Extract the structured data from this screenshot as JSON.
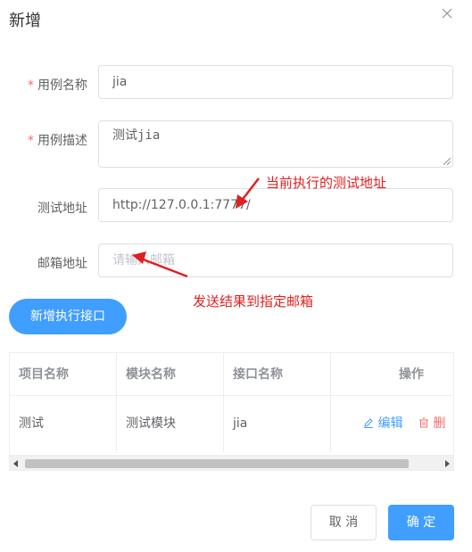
{
  "dialog": {
    "title": "新增"
  },
  "form": {
    "case_name": {
      "label": "用例名称",
      "value": "jia"
    },
    "case_desc": {
      "label": "用例描述",
      "value": "测试jia"
    },
    "test_url": {
      "label": "测试地址",
      "value": "http://127.0.0.1:7777/"
    },
    "email": {
      "label": "邮箱地址",
      "placeholder": "请输入邮箱"
    },
    "required_mark": "*"
  },
  "add_api_button": "新增执行接口",
  "annotations": {
    "test_url_note": "当前执行的测试地址",
    "email_note": "发送结果到指定邮箱"
  },
  "table": {
    "headers": [
      "项目名称",
      "模块名称",
      "接口名称",
      "操作"
    ],
    "rows": [
      {
        "project": "测试",
        "module": "测试模块",
        "api": "jia",
        "edit": "编辑",
        "delete": "删除"
      }
    ]
  },
  "footer": {
    "cancel": "取 消",
    "confirm": "确 定"
  },
  "colors": {
    "primary": "#409eff",
    "danger": "#f56c6c",
    "annotation": "#e02020"
  },
  "icons": [
    "close-icon",
    "edit-icon",
    "delete-icon"
  ]
}
